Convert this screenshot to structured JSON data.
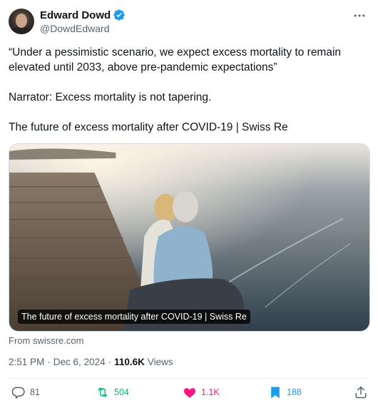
{
  "author": {
    "display_name": "Edward Dowd",
    "handle": "@DowdEdward",
    "verified_color": "#1d9bf0"
  },
  "tweet": {
    "paragraphs": [
      "“Under a pessimistic scenario, we expect excess mortality to remain elevated until 2033, above pre-pandemic expectations”",
      "Narrator: Excess mortality is not tapering.",
      "The future of excess mortality after COVID-19 | Swiss Re"
    ]
  },
  "card": {
    "caption": "The future of excess mortality after COVID-19 | Swiss Re",
    "image_icon": "photo-couple-on-pier",
    "source": "From swissre.com"
  },
  "meta": {
    "time": "2:51 PM",
    "separator1": "·",
    "date": "Dec 6, 2024",
    "separator2": "·",
    "views_count": "110.6K",
    "views_label": "Views"
  },
  "actions": {
    "replies": "81",
    "reposts": "504",
    "likes": "1.1K",
    "bookmarks": "188"
  },
  "icons": {
    "more": "more-dots-icon",
    "reply": "reply-icon",
    "retweet": "retweet-icon",
    "like": "heart-icon",
    "bookmark": "bookmark-icon",
    "share": "share-icon"
  }
}
